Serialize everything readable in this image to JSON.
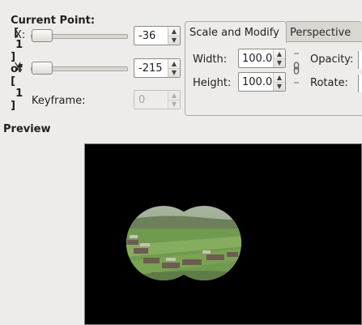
{
  "point": {
    "label": "Current Point:",
    "current_open": "[",
    "current": "1",
    "current_close": "]",
    "of": "of",
    "total_open": "[",
    "total": "1",
    "total_close": "]"
  },
  "fields": {
    "x_label": "X:",
    "x_value": "-36",
    "y_label": "Y:",
    "y_value": "-215",
    "keyframe_label": "Keyframe:",
    "keyframe_value": "0"
  },
  "tabs": {
    "scale_label": "Scale and Modify",
    "perspective_label": "Perspective",
    "width_label": "Width:",
    "width_value": "100.0",
    "height_label": "Height:",
    "height_value": "100.0",
    "opacity_label": "Opacity:",
    "rotate_label": "Rotate:"
  },
  "preview": {
    "label": "Preview"
  },
  "icons": {
    "spin_up": "▲",
    "spin_down": "▼",
    "chain": "chain-link-icon"
  },
  "colors": {
    "preview_bg": "#000000",
    "window_bg": "#edecea"
  }
}
